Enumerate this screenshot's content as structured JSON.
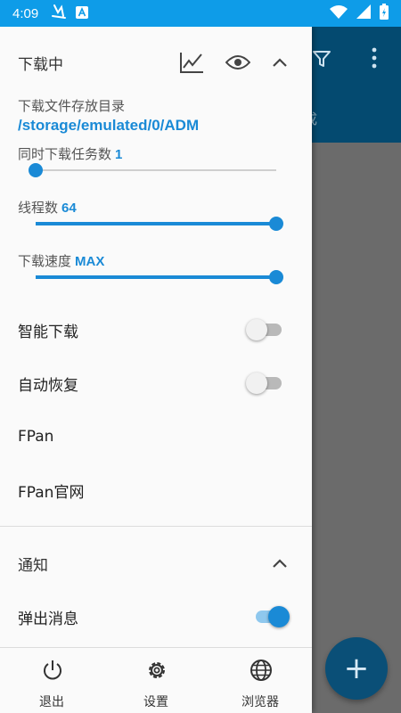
{
  "status_bar": {
    "time": "4:09",
    "left_icons": [
      "gesture-icon",
      "a-badge-icon"
    ],
    "right_icons": [
      "wifi-icon",
      "signal-icon",
      "battery-charging-icon"
    ],
    "color": "#0e9ce8"
  },
  "background": {
    "toolbar_color": "#044a70",
    "tab_fragment": "成",
    "fab_label": "+"
  },
  "downloading": {
    "title": "下载中",
    "icons": [
      "chart-icon",
      "eye-icon",
      "chevron-up-icon"
    ],
    "dir_label": "下载文件存放目录",
    "dir_path": "/storage/emulated/0/ADM",
    "concurrent": {
      "label": "同时下载任务数",
      "value": "1",
      "fraction": 0.0
    },
    "threads": {
      "label": "线程数",
      "value": "64",
      "fraction": 1.0
    },
    "speed": {
      "label": "下载速度",
      "value": "MAX",
      "fraction": 1.0
    }
  },
  "settings_rows": [
    {
      "label": "智能下载",
      "toggle": false
    },
    {
      "label": "自动恢复",
      "toggle": false
    },
    {
      "label": "FPan"
    },
    {
      "label": "FPan官网"
    }
  ],
  "notifications": {
    "title": "通知",
    "popup_label": "弹出消息",
    "popup_on": true
  },
  "bottom_nav": [
    {
      "label": "退出",
      "icon": "power-icon"
    },
    {
      "label": "设置",
      "icon": "gear-icon"
    },
    {
      "label": "浏览器",
      "icon": "globe-icon"
    }
  ],
  "accent_color": "#1a8ad6"
}
